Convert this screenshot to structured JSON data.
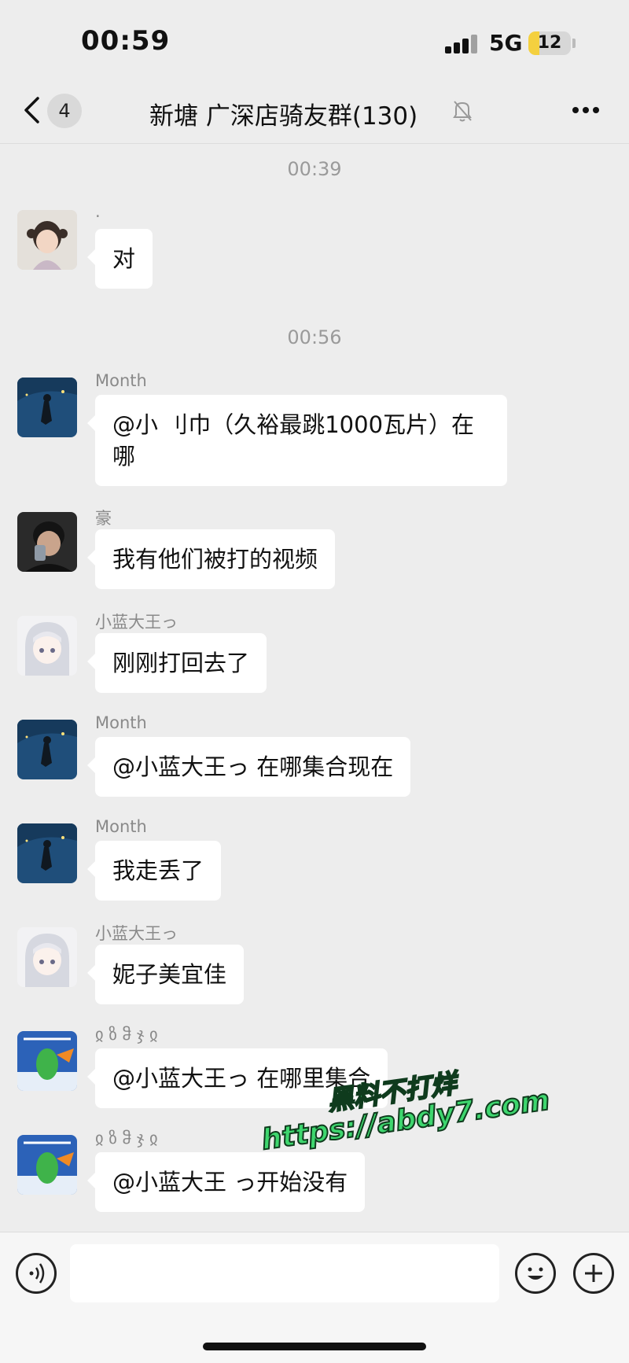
{
  "status_bar": {
    "time": "00:59",
    "network": "5G",
    "battery": "12"
  },
  "nav": {
    "unread_count": "4",
    "title": "新塘 广深店骑友群(130)"
  },
  "timestamps": [
    "00:39",
    "00:56"
  ],
  "messages": [
    {
      "sender": ".",
      "text": "对"
    },
    {
      "sender": "Month",
      "text": "@小 刂巾（久裕最跳1000瓦片）在哪"
    },
    {
      "sender": "豪",
      "text": "我有他们被打的视频"
    },
    {
      "sender": "小蓝大王っ",
      "text": "刚刚打回去了"
    },
    {
      "sender": "Month",
      "text": "@小蓝大王っ 在哪集合现在"
    },
    {
      "sender": "Month",
      "text": "我走丢了"
    },
    {
      "sender": "小蓝大王っ",
      "text": "妮子美宜佳"
    },
    {
      "sender": "ჲ ზ ჵ ჯ ჲ",
      "text": "@小蓝大王っ 在哪里集合"
    },
    {
      "sender": "ჲ ზ ჵ ჯ ჲ",
      "text": "@小蓝大王 っ开始没有"
    }
  ],
  "watermark": {
    "line1": "黑料不打烊",
    "line2": "https://abdy7.com"
  },
  "input": {
    "placeholder": ""
  },
  "icons": {
    "back": "chevron-left-icon",
    "mute": "bell-off-icon",
    "more": "more-icon",
    "voice": "voice-icon",
    "emoji": "emoji-icon",
    "plus": "plus-icon"
  },
  "colors": {
    "background": "#ededed",
    "bubble": "#ffffff",
    "watermark": "#3ed66e"
  }
}
